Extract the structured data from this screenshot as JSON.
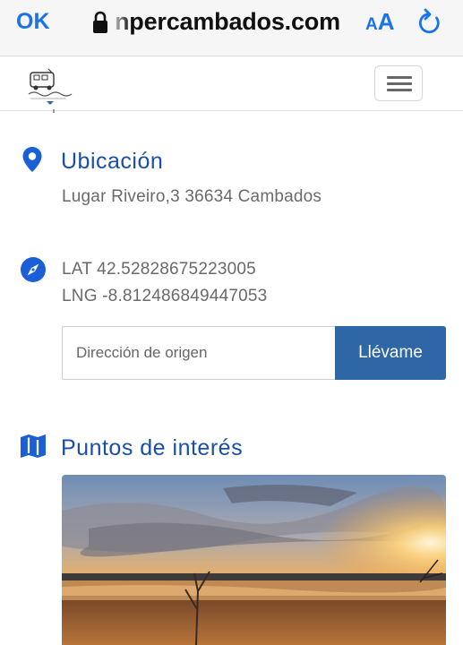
{
  "browser": {
    "done_label": "OK",
    "url": "npercambados.com",
    "text_size_small": "A",
    "text_size_large": "A",
    "lock_icon": "lock-icon",
    "reload_icon": "reload-icon"
  },
  "header": {
    "logo_alt": "Camper Cambados logo",
    "menu_icon": "hamburger-icon"
  },
  "location": {
    "icon": "map-pin-icon",
    "title": "Ubicación",
    "address": "Lugar Riveiro,3 36634 Cambados"
  },
  "coordinates": {
    "icon": "compass-icon",
    "lat": "LAT 42.52828675223005",
    "lng": "LNG -8.812486849447053"
  },
  "route": {
    "placeholder": "Dirección de origen",
    "value": "",
    "button_label": "Llévame"
  },
  "poi": {
    "icon": "map-icon",
    "title": "Puntos de interés",
    "image_alt": "Sunset over beach"
  },
  "colors": {
    "link_blue": "#1a73e8",
    "heading_blue": "#1a4fa8",
    "button_blue": "#2e66a6"
  }
}
